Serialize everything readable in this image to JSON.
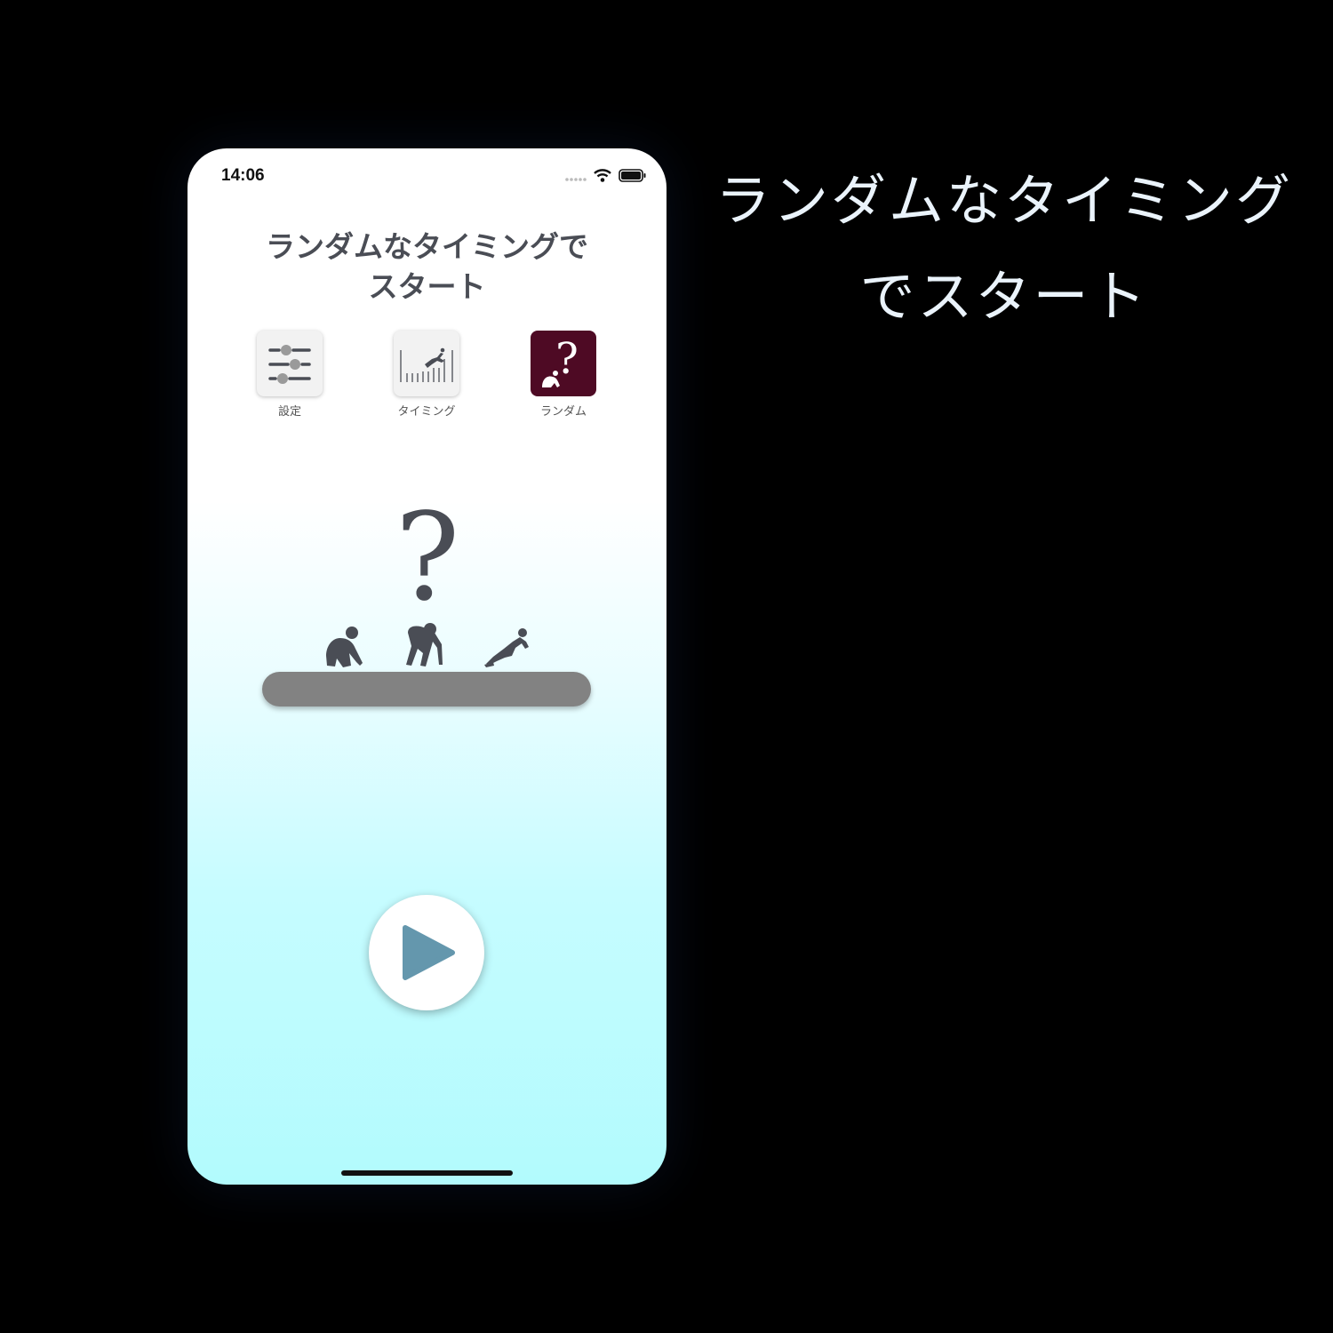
{
  "status_bar": {
    "time": "14:06"
  },
  "header": {
    "title_line1": "ランダムなタイミングで",
    "title_line2": "スタート"
  },
  "menu": {
    "items": [
      {
        "label": "設定",
        "icon": "sliders-icon"
      },
      {
        "label": "タイミング",
        "icon": "timing-runner-icon"
      },
      {
        "label": "ランダム",
        "icon": "random-question-icon",
        "active": true
      }
    ]
  },
  "hero": {
    "glyph": "?"
  },
  "controls": {
    "play_icon": "play-icon",
    "accent_color": "#6497ad"
  },
  "caption": {
    "line1": "ランダムなタイミング",
    "line2": "でスタート"
  },
  "colors": {
    "active_menu": "#4e0a24",
    "track": "#828282",
    "background": "#000000"
  }
}
